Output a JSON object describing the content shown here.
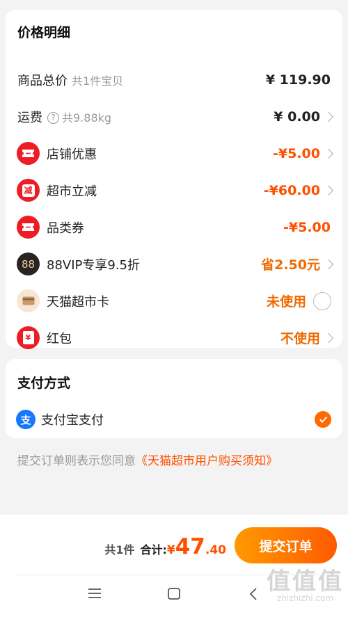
{
  "price_section": {
    "title": "价格明细",
    "rows": [
      {
        "label": "商品总价",
        "sub": "共1件宝贝",
        "value": "¥ 119.90"
      },
      {
        "label": "运费",
        "sub": "共9.88kg",
        "value": "¥ 0.00"
      },
      {
        "label": "店铺优惠",
        "value": "-¥5.00",
        "icon": "ticket-icon"
      },
      {
        "label": "超市立减",
        "value": "-¥60.00",
        "icon": "reduction-icon",
        "icon_text": "减"
      },
      {
        "label": "品类券",
        "value": "-¥5.00",
        "icon": "ticket-icon"
      },
      {
        "label": "88VIP专享9.5折",
        "value": "省2.50元",
        "icon": "vip88-icon",
        "icon_text": "88"
      },
      {
        "label": "天猫超市卡",
        "value": "未使用",
        "icon": "card-icon"
      },
      {
        "label": "红包",
        "value": "不使用",
        "icon": "red-envelope-icon",
        "icon_text": "¥"
      }
    ]
  },
  "payment_section": {
    "title": "支付方式",
    "method": "支付宝支付",
    "icon_text": "支"
  },
  "agreement": {
    "prefix": "提交订单则表示您同意",
    "link": "《天猫超市用户购买须知》"
  },
  "footer": {
    "count": "共1件",
    "total_label": "合计:",
    "currency": "¥",
    "total_int": "47",
    "total_dec": ".40",
    "submit_label": "提交订单"
  },
  "watermark": {
    "glyphs": "值值值",
    "url": "zhizhizhi.com"
  },
  "colors": {
    "accent": "#ff5000",
    "red_icon": "#ee1c25",
    "vip_dark": "#2a2420"
  }
}
